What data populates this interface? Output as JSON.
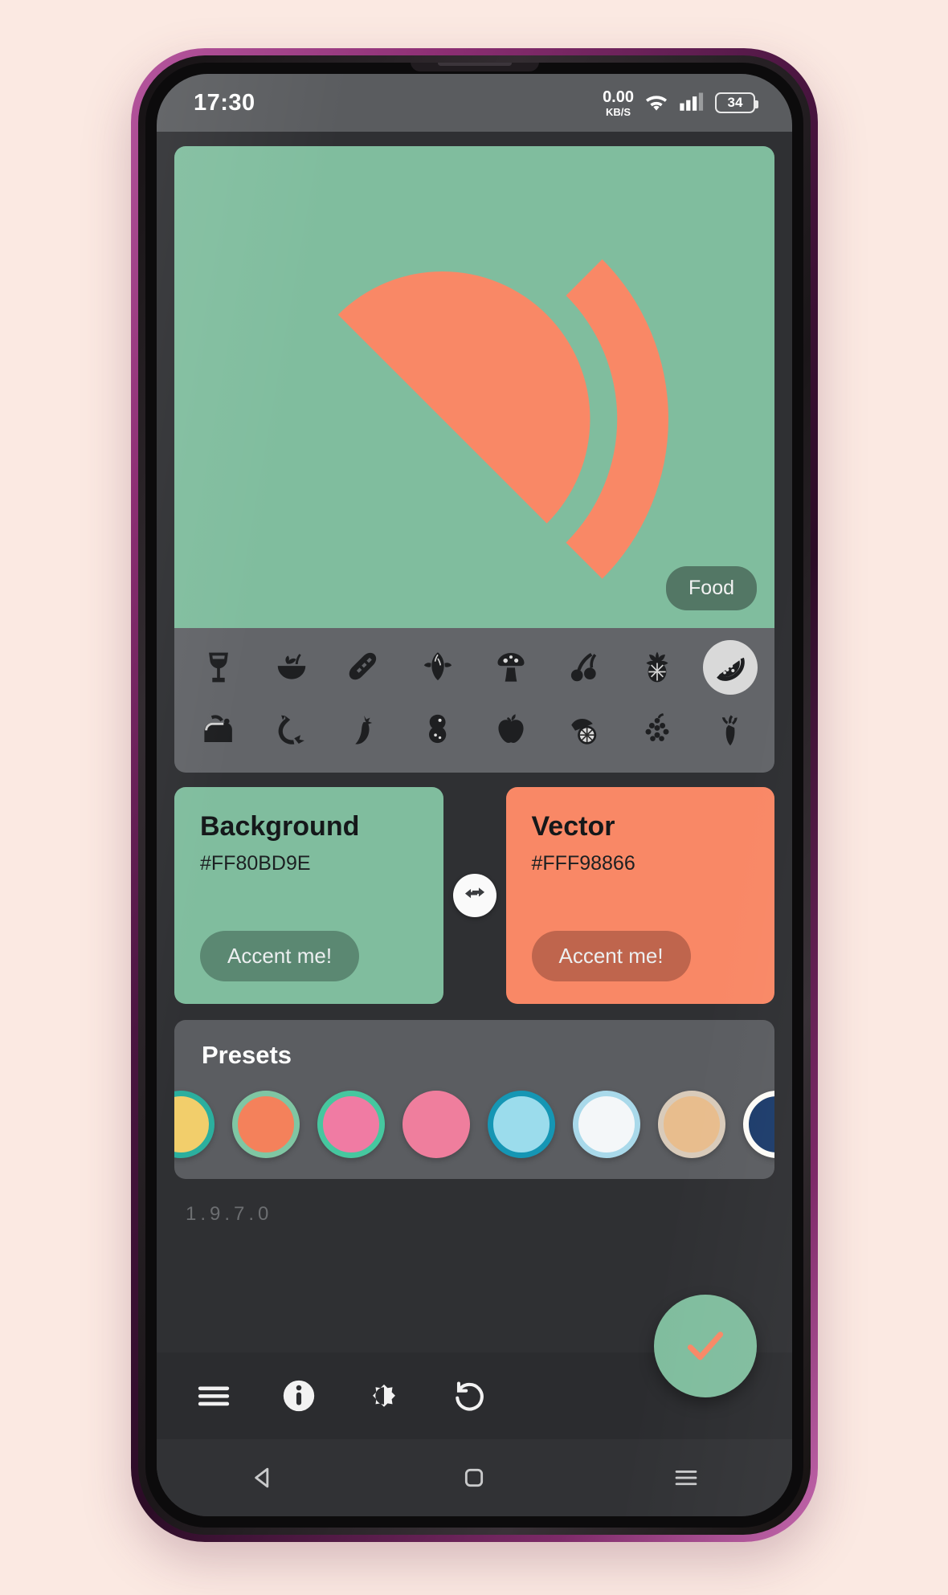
{
  "status_bar": {
    "time": "17:30",
    "net_speed_value": "0.00",
    "net_speed_unit": "KB/S",
    "wifi_icon": "wifi-icon",
    "signal_icon": "cellular-signal-icon",
    "battery_level": "34"
  },
  "preview": {
    "background_color": "#80BD9E",
    "vector_color": "#F98866",
    "icon_name": "watermelon-slice-icon",
    "category_badge": "Food"
  },
  "icon_picker": {
    "row1": [
      {
        "name": "wine-glass-icon",
        "selected": false
      },
      {
        "name": "salad-bowl-icon",
        "selected": false
      },
      {
        "name": "bread-baguette-icon",
        "selected": false
      },
      {
        "name": "corn-cob-icon",
        "selected": false
      },
      {
        "name": "mushroom-icon",
        "selected": false
      },
      {
        "name": "cherries-icon",
        "selected": false
      },
      {
        "name": "pineapple-icon",
        "selected": false
      },
      {
        "name": "watermelon-slice-icon",
        "selected": true
      }
    ],
    "row2": [
      {
        "name": "toaster-bread-icon",
        "selected": false
      },
      {
        "name": "sausage-icon",
        "selected": false
      },
      {
        "name": "chili-pepper-icon",
        "selected": false
      },
      {
        "name": "peanut-icon",
        "selected": false
      },
      {
        "name": "apple-icon",
        "selected": false
      },
      {
        "name": "lemon-slice-icon",
        "selected": false
      },
      {
        "name": "grapes-icon",
        "selected": false
      },
      {
        "name": "carrot-icon",
        "selected": false
      }
    ]
  },
  "color_cards": {
    "background": {
      "title": "Background",
      "hex": "#FF80BD9E",
      "swatch": "#80BD9E",
      "accent_label": "Accent me!"
    },
    "vector": {
      "title": "Vector",
      "hex": "#FFF98866",
      "swatch": "#F98866",
      "accent_label": "Accent me!"
    },
    "swap_icon": "swap-horizontal-icon"
  },
  "presets": {
    "title": "Presets",
    "swatches": [
      {
        "name": "preset-yellow-teal",
        "fill": "#F2CE6B",
        "ring": "#2BAF9E"
      },
      {
        "name": "preset-orange-green",
        "fill": "#F4815B",
        "ring": "#7FC6A3"
      },
      {
        "name": "preset-pink-green",
        "fill": "#F07BA3",
        "ring": "#46C79F"
      },
      {
        "name": "preset-pink-plain",
        "fill": "#EF7E9D",
        "ring": "#EF7E9D"
      },
      {
        "name": "preset-lightblue-teal",
        "fill": "#9BDCEC",
        "ring": "#1596B4"
      },
      {
        "name": "preset-white-blue",
        "fill": "#F4F7F9",
        "ring": "#A9D9EA"
      },
      {
        "name": "preset-tan",
        "fill": "#E8BD8D",
        "ring": "#D9CBBA"
      },
      {
        "name": "preset-navy-white",
        "fill": "#1D3C6B",
        "ring": "#FDFBF6"
      }
    ]
  },
  "footer": {
    "version": "1.9.7.0"
  },
  "app_bar": {
    "items": [
      {
        "name": "menu-icon",
        "label": "Menu"
      },
      {
        "name": "info-icon",
        "label": "Info"
      },
      {
        "name": "brightness-theme-icon",
        "label": "Theme"
      },
      {
        "name": "reset-undo-icon",
        "label": "Reset"
      }
    ],
    "fab": {
      "name": "apply-check-button",
      "icon": "check-icon",
      "background": "#80BD9E",
      "check_color": "#F98866"
    }
  },
  "android_nav": {
    "back_icon": "back-triangle-icon",
    "home_icon": "home-square-icon",
    "recents_icon": "recents-menu-icon"
  },
  "colors": {
    "page_background": "#FBE9E2",
    "screen_background": "#2F3033",
    "panel_gray": "#5B5D61",
    "status_bar": "#5A5C5F"
  }
}
